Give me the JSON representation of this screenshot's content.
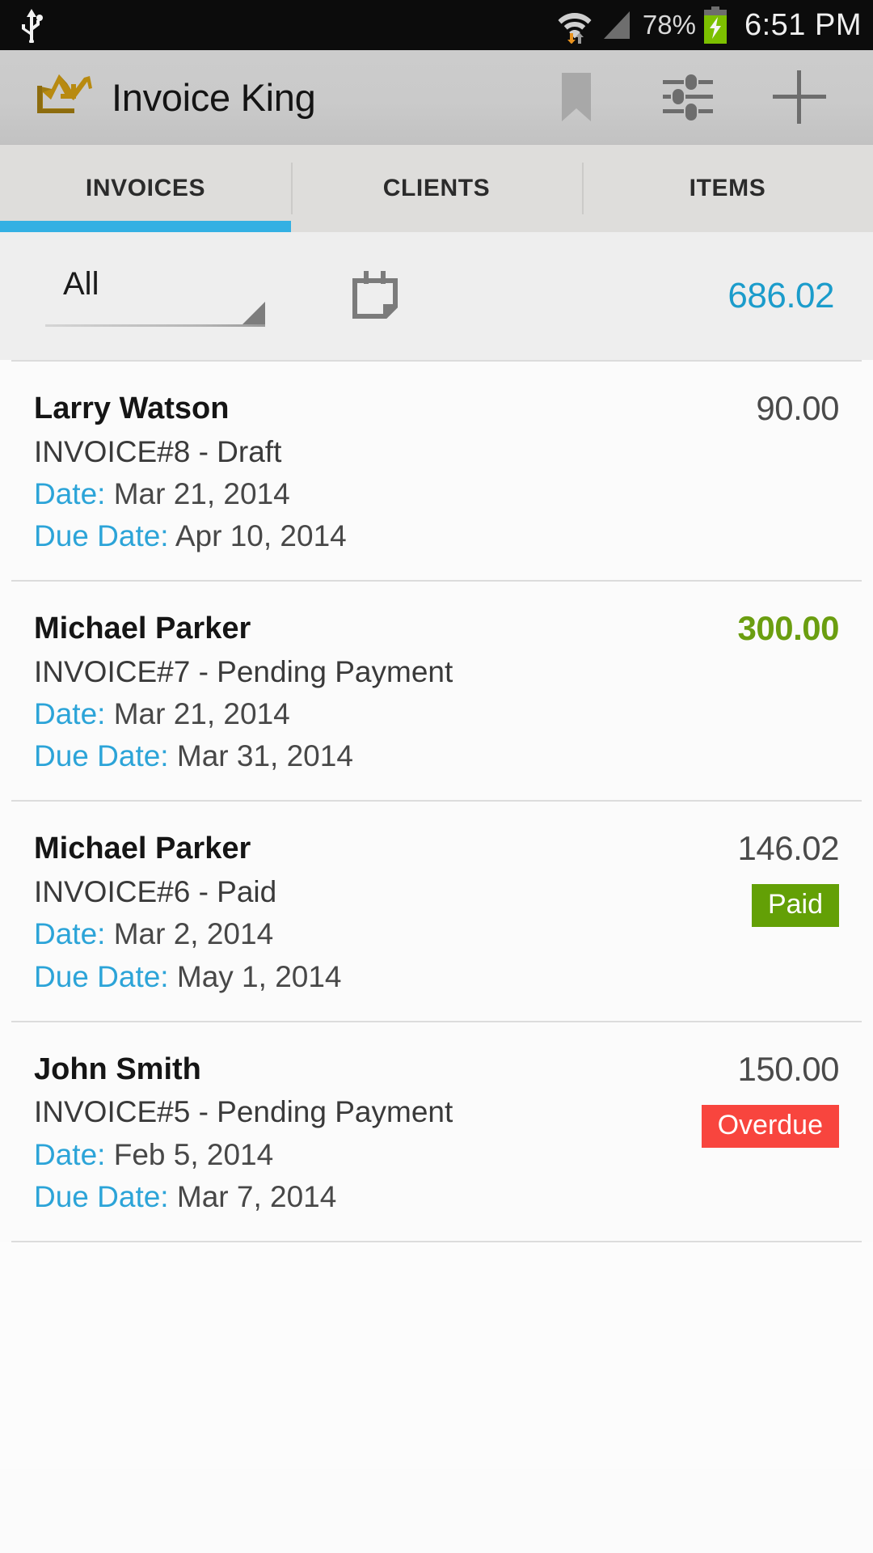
{
  "status_bar": {
    "usb_icon": "usb-icon",
    "wifi_icon": "wifi-icon",
    "signal_icon": "signal-icon",
    "battery_percent": "78%",
    "battery_icon": "battery-charging-icon",
    "time": "6:51 PM"
  },
  "app_bar": {
    "logo_icon": "crown-logo-icon",
    "title": "Invoice King",
    "actions": [
      {
        "name": "bookmark",
        "icon": "bookmark-icon"
      },
      {
        "name": "settings",
        "icon": "sliders-icon"
      },
      {
        "name": "add",
        "icon": "plus-icon"
      }
    ]
  },
  "tabs": {
    "items": [
      {
        "label": "INVOICES",
        "selected": true
      },
      {
        "label": "CLIENTS",
        "selected": false
      },
      {
        "label": "ITEMS",
        "selected": false
      }
    ],
    "indicator_color": "#33b0e3"
  },
  "filter_bar": {
    "spinner_value": "All",
    "spinner_arrow_icon": "dropdown-triangle-icon",
    "calendar_icon": "calendar-icon",
    "total": "686.02",
    "total_color": "#1b9ccb"
  },
  "invoices": [
    {
      "client": "Larry Watson",
      "invoice_line": "INVOICE#8 - Draft",
      "date_label": "Date:",
      "date_value": "Mar 21, 2014",
      "due_label": "Due Date:",
      "due_value": "Apr 10, 2014",
      "amount": "90.00",
      "amount_style": "gray",
      "badge": null
    },
    {
      "client": "Michael Parker",
      "invoice_line": "INVOICE#7 - Pending Payment",
      "date_label": "Date:",
      "date_value": "Mar 21, 2014",
      "due_label": "Due Date:",
      "due_value": "Mar 31, 2014",
      "amount": "300.00",
      "amount_style": "green",
      "badge": null
    },
    {
      "client": "Michael Parker",
      "invoice_line": "INVOICE#6 - Paid",
      "date_label": "Date:",
      "date_value": "Mar 2, 2014",
      "due_label": "Due Date:",
      "due_value": "May 1, 2014",
      "amount": "146.02",
      "amount_style": "gray",
      "badge": {
        "label": "Paid",
        "kind": "paid",
        "color": "#63a006"
      }
    },
    {
      "client": "John Smith",
      "invoice_line": "INVOICE#5 - Pending Payment",
      "date_label": "Date:",
      "date_value": "Feb 5, 2014",
      "due_label": "Due Date:",
      "due_value": "Mar 7, 2014",
      "amount": "150.00",
      "amount_style": "gray",
      "badge": {
        "label": "Overdue",
        "kind": "overdue",
        "color": "#f8453e"
      }
    }
  ]
}
